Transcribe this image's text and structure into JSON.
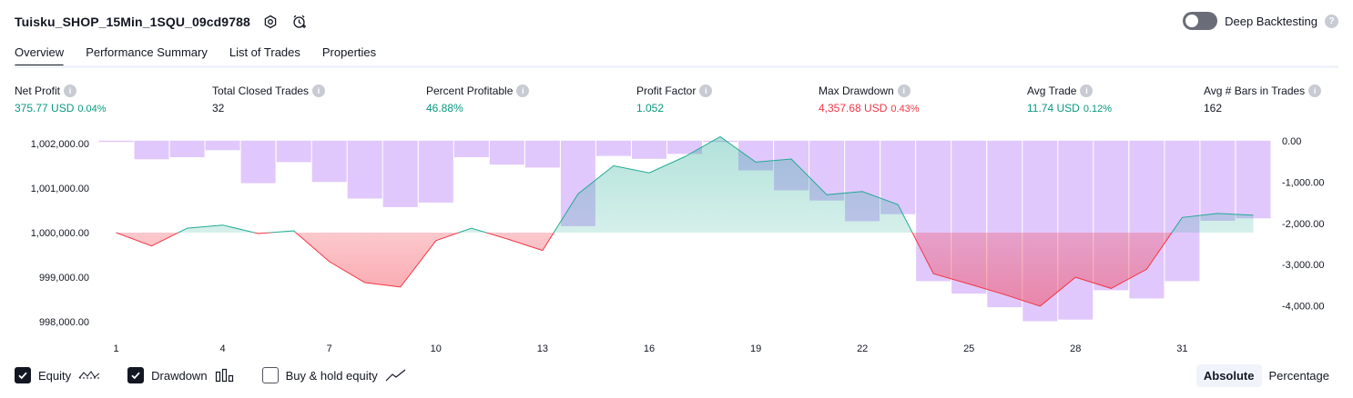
{
  "header": {
    "title": "Tuisku_SHOP_15Min_1SQU_09cd9788",
    "deep_backtesting_label": "Deep Backtesting",
    "help_glyph": "?"
  },
  "tabs": [
    {
      "label": "Overview",
      "active": true
    },
    {
      "label": "Performance Summary",
      "active": false
    },
    {
      "label": "List of Trades",
      "active": false
    },
    {
      "label": "Properties",
      "active": false
    }
  ],
  "metrics": [
    {
      "label": "Net Profit",
      "value": "375.77 USD",
      "pct": "0.04%",
      "tone": "pos"
    },
    {
      "label": "Total Closed Trades",
      "value": "32",
      "pct": "",
      "tone": "neu"
    },
    {
      "label": "Percent Profitable",
      "value": "46.88%",
      "pct": "",
      "tone": "pos"
    },
    {
      "label": "Profit Factor",
      "value": "1.052",
      "pct": "",
      "tone": "pos"
    },
    {
      "label": "Max Drawdown",
      "value": "4,357.68 USD",
      "pct": "0.43%",
      "tone": "neg"
    },
    {
      "label": "Avg Trade",
      "value": "11.74 USD",
      "pct": "0.12%",
      "tone": "pos"
    },
    {
      "label": "Avg # Bars in Trades",
      "value": "162",
      "pct": "",
      "tone": "neu"
    }
  ],
  "info_glyph": "i",
  "legend": {
    "equity": {
      "label": "Equity",
      "checked": true
    },
    "drawdown": {
      "label": "Drawdown",
      "checked": true
    },
    "buy_hold": {
      "label": "Buy & hold equity",
      "checked": false
    }
  },
  "mode": {
    "absolute_label": "Absolute",
    "percentage_label": "Percentage",
    "active": "Absolute"
  },
  "colors": {
    "positive": "#089981",
    "negative": "#f23645",
    "drawdown_bar": "#e1c8fc",
    "equity_pos_line": "#22ab94",
    "equity_neg_line": "#f23645"
  },
  "chart_data": [
    {
      "type": "line",
      "name": "Equity",
      "x": [
        1,
        2,
        3,
        4,
        5,
        6,
        7,
        8,
        9,
        10,
        11,
        12,
        13,
        14,
        15,
        16,
        17,
        18,
        19,
        20,
        21,
        22,
        23,
        24,
        25,
        26,
        27,
        28,
        29,
        30,
        31,
        32,
        33
      ],
      "values": [
        1000000,
        999700,
        1000100,
        1000170,
        999980,
        1000040,
        999350,
        998880,
        998780,
        999820,
        1000100,
        999860,
        999600,
        1000870,
        1001500,
        1001340,
        1001700,
        1002150,
        1001580,
        1001650,
        1000850,
        1000920,
        1000630,
        999080,
        998850,
        998610,
        998350,
        999000,
        998750,
        999180,
        1000340,
        1000430,
        1000390
      ],
      "ylim": [
        997800,
        1002200
      ],
      "y_ticks": [
        "1,002,000.00",
        "1,001,000.00",
        "1,000,000.00",
        "999,000.00",
        "998,000.00"
      ],
      "y_tick_values": [
        1002000,
        1001000,
        1000000,
        999000,
        998000
      ]
    },
    {
      "type": "bar",
      "name": "Drawdown",
      "x": [
        1,
        2,
        3,
        4,
        5,
        6,
        7,
        8,
        9,
        10,
        11,
        12,
        13,
        14,
        15,
        16,
        17,
        18,
        19,
        20,
        21,
        22,
        23,
        24,
        25,
        26,
        27,
        28,
        29,
        30,
        31,
        32,
        33
      ],
      "values": [
        0,
        -450,
        -400,
        -230,
        -1030,
        -520,
        -1000,
        -1400,
        -1610,
        -1500,
        -400,
        -580,
        -650,
        -2070,
        -370,
        -440,
        -320,
        0,
        -720,
        -1200,
        -1450,
        -1950,
        -1780,
        -3400,
        -3700,
        -4030,
        -4370,
        -4330,
        -3620,
        -3820,
        -3400,
        -1940,
        -1880
      ],
      "ylim": [
        -4600,
        150
      ],
      "y_ticks": [
        "0.00",
        "-1,000.00",
        "-2,000.00",
        "-3,000.00",
        "-4,000.00"
      ],
      "y_tick_values": [
        0,
        -1000,
        -2000,
        -3000,
        -4000
      ]
    }
  ],
  "x_ticks": [
    "1",
    "4",
    "7",
    "10",
    "13",
    "16",
    "19",
    "22",
    "25",
    "28",
    "31"
  ]
}
